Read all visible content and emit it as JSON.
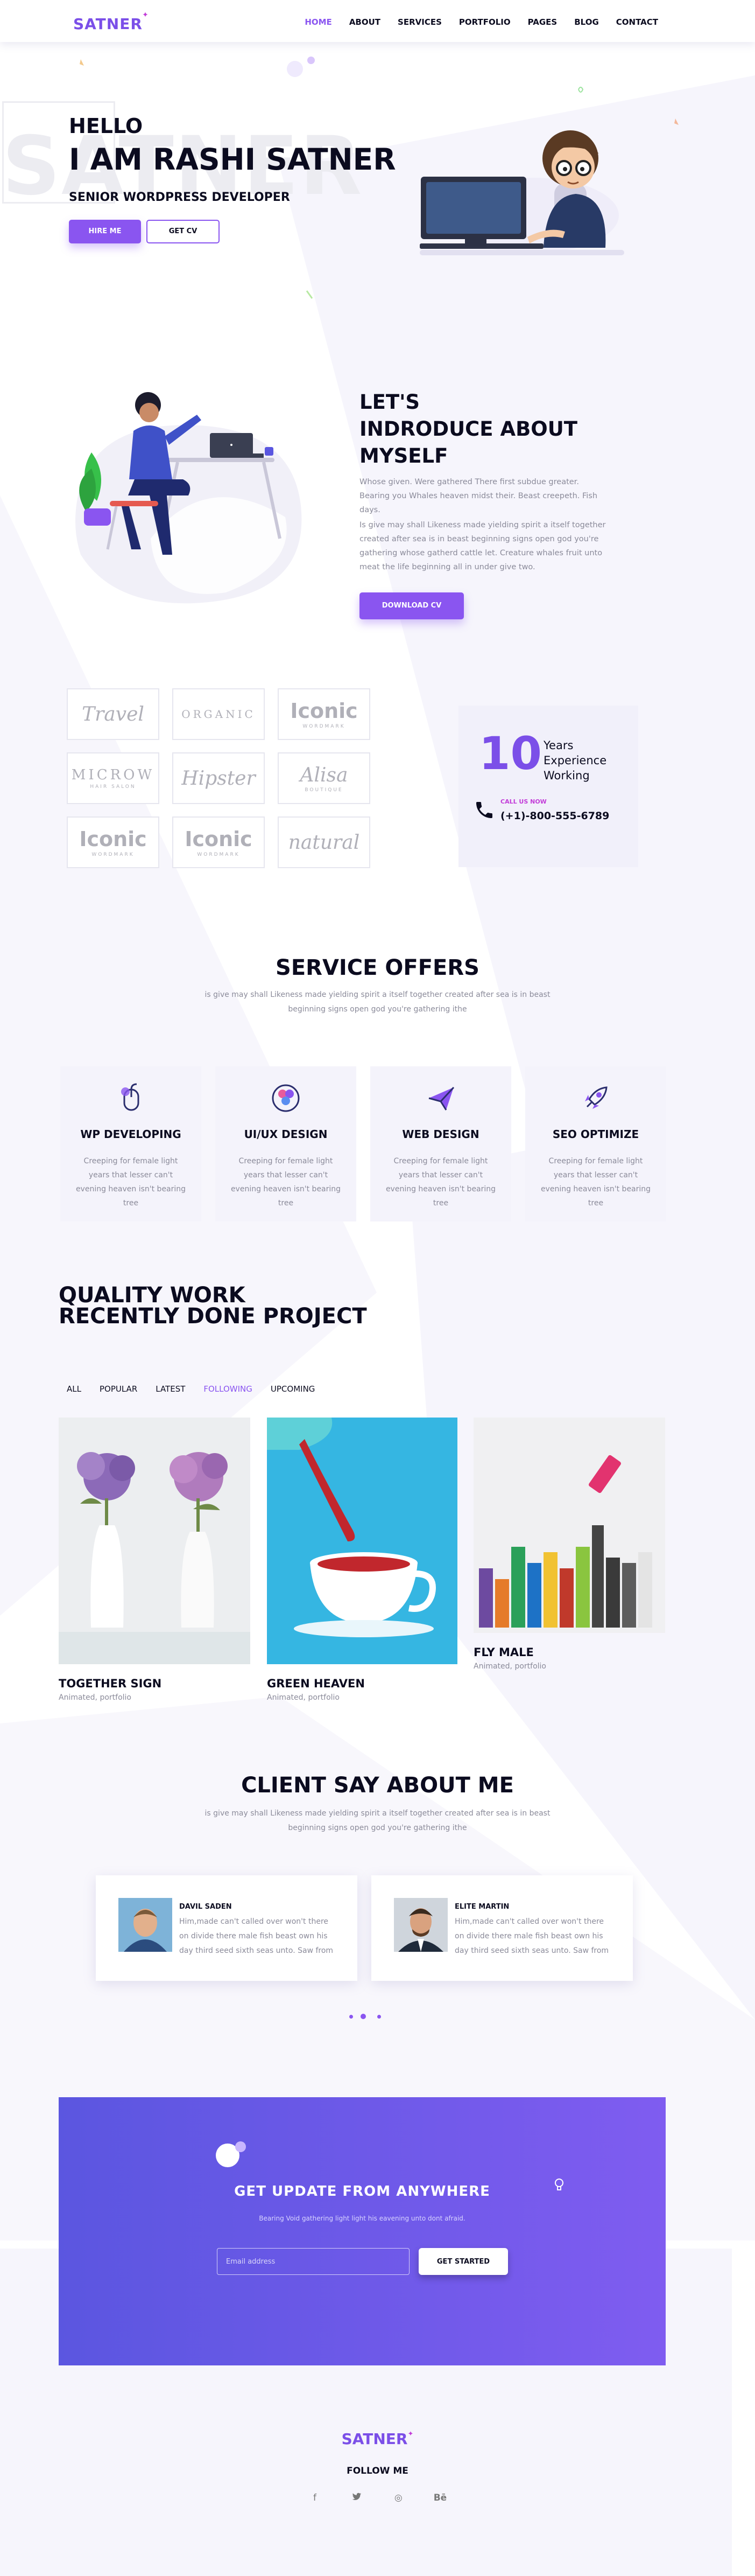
{
  "brand": {
    "name": "SATNER"
  },
  "nav": [
    {
      "label": "HOME",
      "active": true
    },
    {
      "label": "ABOUT",
      "active": false
    },
    {
      "label": "SERVICES",
      "active": false
    },
    {
      "label": "PORTFOLIO",
      "active": false
    },
    {
      "label": "PAGES",
      "active": false
    },
    {
      "label": "BLOG",
      "active": false
    },
    {
      "label": "CONTACT",
      "active": false
    }
  ],
  "hero": {
    "watermark": "SATNER",
    "hello": "HELLO",
    "name": "I AM RASHI SATNER",
    "role": "SENIOR WORDPRESS DEVELOPER",
    "hire_label": "HIRE ME",
    "cv_label": "GET CV"
  },
  "about": {
    "title_line1": "LET'S",
    "title_line2": "INDRODUCE ABOUT",
    "title_line3": "MYSELF",
    "para1": "Whose given. Were gathered There first subdue greater. Bearing you Whales heaven midst their. Beast creepeth. Fish days.",
    "para2": "Is give may shall Likeness made yielding spirit a itself together created after sea is in beast beginning signs open god you're gathering whose gatherd cattle let. Creature whales fruit unto meat the life beginning all in under give two.",
    "download_label": "DOWNLOAD CV"
  },
  "brands": [
    {
      "main": "Travel",
      "sub": "",
      "style": "big"
    },
    {
      "main": "ORGANIC",
      "sub": "",
      "style": "caps"
    },
    {
      "main": "Iconic",
      "sub": "WORDMARK",
      "style": "bold"
    },
    {
      "main": "MICROW",
      "sub": "HAIR SALON",
      "style": "caps"
    },
    {
      "main": "Hipster",
      "sub": "",
      "style": "big"
    },
    {
      "main": "Alisa",
      "sub": "BOUTIQUE",
      "style": "big"
    },
    {
      "main": "Iconic",
      "sub": "WORDMARK",
      "style": "bold"
    },
    {
      "main": "Iconic",
      "sub": "WORDMARK",
      "style": "bold"
    },
    {
      "main": "natural",
      "sub": "",
      "style": "big"
    }
  ],
  "experience": {
    "number": "10",
    "label": "Years Experience Working",
    "call_label": "CALL US NOW",
    "phone": "(+1)-800-555-6789"
  },
  "services": {
    "title": "SERVICE OFFERS",
    "subtitle": "is give may shall Likeness made yielding spirit a itself together created after sea is in beast beginning signs open god you're gathering ithe",
    "items": [
      {
        "title": "WP DEVELOPING",
        "icon": "mouse-icon",
        "text": "Creeping for female light years that lesser can't evening heaven isn't bearing tree"
      },
      {
        "title": "UI/UX DESIGN",
        "icon": "palette-icon",
        "text": "Creeping for female light years that lesser can't evening heaven isn't bearing tree"
      },
      {
        "title": "WEB DESIGN",
        "icon": "paper-plane-icon",
        "text": "Creeping for female light years that lesser can't evening heaven isn't bearing tree"
      },
      {
        "title": "SEO OPTIMIZE",
        "icon": "rocket-icon",
        "text": "Creeping for female light years that lesser can't evening heaven isn't bearing tree"
      }
    ]
  },
  "projects": {
    "title_line1": "QUALITY WORK",
    "title_line2": "RECENTLY DONE PROJECT",
    "filters": [
      "ALL",
      "POPULAR",
      "LATEST",
      "FOLLOWING",
      "UPCOMING"
    ],
    "active_filter": "FOLLOWING",
    "items": [
      {
        "name": "TOGETHER SIGN",
        "category": "Animated, portfolio"
      },
      {
        "name": "GREEN HEAVEN",
        "category": "Animated, portfolio"
      },
      {
        "name": "FLY MALE",
        "category": "Animated, portfolio"
      }
    ]
  },
  "testimonials": {
    "title": "CLIENT SAY ABOUT ME",
    "subtitle": "is give may shall Likeness made yielding spirit a itself together created after sea is in beast beginning signs open god you're gathering ithe",
    "items": [
      {
        "name": "DAVIL SADEN",
        "text": "Him,made can't called over won't there on divide there male fish beast own his day third seed sixth seas unto. Saw from"
      },
      {
        "name": "ELITE MARTIN",
        "text": "Him,made can't called over won't there on divide there male fish beast own his day third seed sixth seas unto. Saw from"
      }
    ]
  },
  "newsletter": {
    "title": "GET UPDATE FROM ANYWHERE",
    "subtitle": "Bearing Void gathering light light his eavening unto dont afraid.",
    "placeholder": "Email address",
    "button": "GET STARTED"
  },
  "footer": {
    "brand": "SATNER",
    "follow": "FOLLOW ME",
    "socials": [
      {
        "icon": "facebook-icon",
        "glyph": "f"
      },
      {
        "icon": "twitter-icon",
        "glyph": "🐦"
      },
      {
        "icon": "dribbble-icon",
        "glyph": "◎"
      },
      {
        "icon": "behance-icon",
        "glyph": "Bē"
      }
    ]
  },
  "colors": {
    "accent": "#8a55f0",
    "brand": "#7b4fe8",
    "pink": "#c23bd8",
    "text": "#0b0b1f",
    "muted": "#8b8b9a",
    "newsletter_from": "#5b56e0",
    "newsletter_to": "#7f5cf0"
  }
}
